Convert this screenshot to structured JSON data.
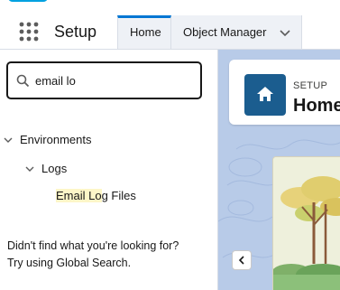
{
  "app": {
    "name": "Setup"
  },
  "nav": {
    "tabs": [
      {
        "label": "Home"
      },
      {
        "label": "Object Manager"
      }
    ]
  },
  "sidebar": {
    "search": {
      "value": "email lo"
    },
    "tree": {
      "environments": "Environments",
      "logs": "Logs",
      "leaf_highlight": "Email Lo",
      "leaf_rest": "g Files"
    },
    "help_line1": "Didn't find what you're looking for?",
    "help_line2": "Try using Global Search."
  },
  "content": {
    "card": {
      "eyebrow": "SETUP",
      "title": "Home"
    }
  },
  "colors": {
    "accent": "#0176d3",
    "home_icon_bg": "#1b5d8f",
    "highlight": "#fdf6c8",
    "content_bg": "#b8cbe8",
    "brand_cloud": "#00a1e0"
  },
  "icons": {
    "app_launcher": "app-launcher-grid-icon",
    "search": "search-icon",
    "chevron": "chevron-down-icon",
    "home": "home-icon",
    "prev": "chevron-left-icon"
  }
}
